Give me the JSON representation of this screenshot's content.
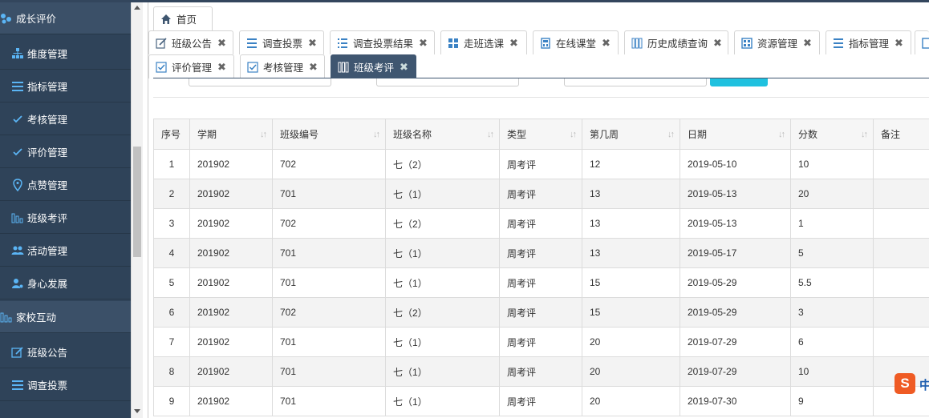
{
  "sidebar": {
    "groups": [
      {
        "label": "成长评价",
        "icon": "group-icon"
      },
      {
        "label": "家校互动",
        "icon": "chart-bars-icon"
      }
    ],
    "items": [
      {
        "label": "维度管理",
        "icon": "hierarchy-icon"
      },
      {
        "label": "指标管理",
        "icon": "list-icon"
      },
      {
        "label": "考核管理",
        "icon": "check-icon"
      },
      {
        "label": "评价管理",
        "icon": "check-icon"
      },
      {
        "label": "点赞管理",
        "icon": "map-pin-icon"
      },
      {
        "label": "班级考评",
        "icon": "chart-bars-icon"
      },
      {
        "label": "活动管理",
        "icon": "users-icon"
      },
      {
        "label": "身心发展",
        "icon": "user-icon"
      },
      {
        "label": "班级公告",
        "icon": "edit-icon"
      },
      {
        "label": "调查投票",
        "icon": "list-icon"
      }
    ]
  },
  "tabs": {
    "home": {
      "label": "首页",
      "icon": "home-icon"
    },
    "row1": [
      {
        "label": "班级公告",
        "icon": "edit-icon"
      },
      {
        "label": "调查投票",
        "icon": "list-icon"
      },
      {
        "label": "调查投票结果",
        "icon": "list-icon"
      },
      {
        "label": "走班选课",
        "icon": "grid-icon"
      },
      {
        "label": "在线课堂",
        "icon": "calculator-icon"
      },
      {
        "label": "历史成绩查询",
        "icon": "columns-icon"
      },
      {
        "label": "资源管理",
        "icon": "table-icon"
      },
      {
        "label": "指标管理",
        "icon": "list-icon"
      }
    ],
    "row2": [
      {
        "label": "评价管理",
        "icon": "checkbox-icon"
      },
      {
        "label": "考核管理",
        "icon": "checkbox-icon"
      },
      {
        "label": "班级考评",
        "icon": "columns-icon",
        "active": true
      }
    ],
    "close_glyph": "✖"
  },
  "table": {
    "columns": [
      "序号",
      "学期",
      "班级编号",
      "班级名称",
      "类型",
      "第几周",
      "日期",
      "分数",
      "备注"
    ],
    "rows": [
      [
        "1",
        "201902",
        "702",
        "七（2）",
        "周考评",
        "12",
        "2019-05-10",
        "10",
        ""
      ],
      [
        "2",
        "201902",
        "701",
        "七（1）",
        "周考评",
        "13",
        "2019-05-13",
        "20",
        ""
      ],
      [
        "3",
        "201902",
        "702",
        "七（2）",
        "周考评",
        "13",
        "2019-05-13",
        "1",
        ""
      ],
      [
        "4",
        "201902",
        "701",
        "七（1）",
        "周考评",
        "13",
        "2019-05-17",
        "5",
        ""
      ],
      [
        "5",
        "201902",
        "701",
        "七（1）",
        "周考评",
        "15",
        "2019-05-29",
        "5.5",
        ""
      ],
      [
        "6",
        "201902",
        "702",
        "七（2）",
        "周考评",
        "15",
        "2019-05-29",
        "3",
        ""
      ],
      [
        "7",
        "201902",
        "701",
        "七（1）",
        "周考评",
        "20",
        "2019-07-29",
        "6",
        ""
      ],
      [
        "8",
        "201902",
        "701",
        "七（1）",
        "周考评",
        "20",
        "2019-07-29",
        "10",
        ""
      ],
      [
        "9",
        "201902",
        "701",
        "七（1）",
        "周考评",
        "20",
        "2019-07-30",
        "9",
        ""
      ]
    ]
  },
  "ime": {
    "logo": "S",
    "lang": "中"
  },
  "colors": {
    "sidebar": "#2f4359",
    "sidebar_group": "#3b5068",
    "active_tab": "#3f5670",
    "search_button": "#1fc1df"
  }
}
